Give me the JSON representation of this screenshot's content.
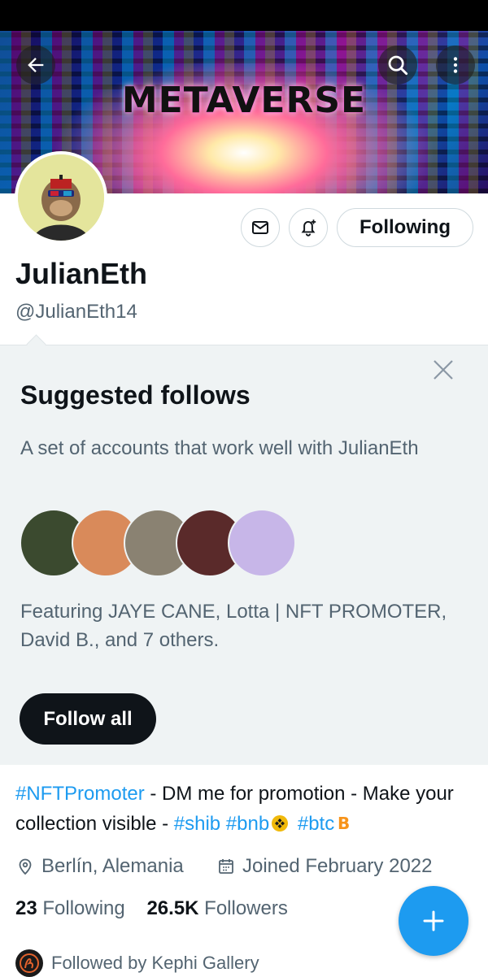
{
  "banner": {
    "title": "METAVERSE"
  },
  "profile": {
    "name": "JulianEth",
    "handle": "@JulianEth14",
    "follow_label": "Following"
  },
  "suggested": {
    "title": "Suggested follows",
    "description": "A set of accounts that work well with JulianEth",
    "featuring": "Featuring JAYE CANE, Lotta | NFT PROMOTER, David B., and 7 others.",
    "follow_all_label": "Follow all",
    "avatar_colors": [
      "#3b4a2f",
      "#d98a5a",
      "#8a8272",
      "#5a2a2a",
      "#c7b6e8"
    ]
  },
  "bio": {
    "tag_nft": "#NFTPromoter",
    "text1": " - DM me for promotion - Make your collection visible - ",
    "tag_shib": "#shib",
    "tag_bnb": "#bnb",
    "tag_btc": "#btc"
  },
  "meta": {
    "location": "Berlín, Alemania",
    "joined": "Joined February 2022"
  },
  "stats": {
    "following_count": "23",
    "following_label": "Following",
    "followers_count": "26.5K",
    "followers_label": "Followers"
  },
  "followed_by": "Followed by Kephi Gallery",
  "colors": {
    "accent": "#1d9bf0",
    "dark": "#0f1419",
    "muted": "#536471",
    "panel": "#eff3f4"
  }
}
